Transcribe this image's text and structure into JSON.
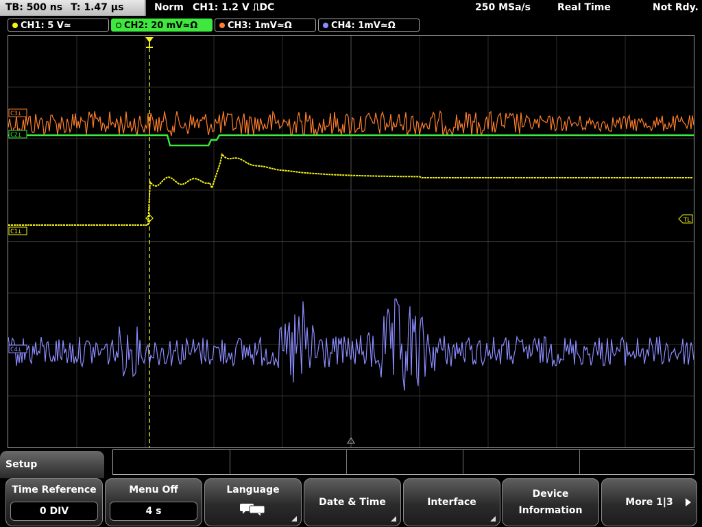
{
  "topbar": {
    "timebase": "TB: 500 ns",
    "trigger_time": "T: 1.47 µs",
    "mode": "Norm",
    "trigger_info": "CH1: 1.2 V ⎍DC",
    "sample_rate": "250 MSa/s",
    "acq_mode": "Real Time",
    "status": "Not Rdy."
  },
  "channels": [
    {
      "label": "CH1: 5 V≃",
      "color": "#f5f516",
      "active": false
    },
    {
      "label": "CH2: 20 mV≃Ω",
      "color": "#3ee83e",
      "active": true
    },
    {
      "label": "CH3: 1mV≃Ω",
      "color": "#ff7f2a",
      "active": false
    },
    {
      "label": "CH4: 1mV≃Ω",
      "color": "#8c8cff",
      "active": false
    }
  ],
  "markers": {
    "c3": "C3⊥",
    "c2": "C2⊥",
    "c1": "C1⊥",
    "c4": "C4⊥",
    "tl": "TL"
  },
  "menu": {
    "title": "Setup",
    "softkeys": [
      {
        "label": "Time Reference",
        "value": "0 DIV"
      },
      {
        "label": "Menu Off",
        "value": "4 s"
      },
      {
        "label": "Language",
        "icon": "speech-bubbles-icon"
      },
      {
        "label": "Date & Time"
      },
      {
        "label": "Interface"
      },
      {
        "label_line1": "Device",
        "label_line2": "Information"
      },
      {
        "label": "More 1|3"
      }
    ]
  }
}
